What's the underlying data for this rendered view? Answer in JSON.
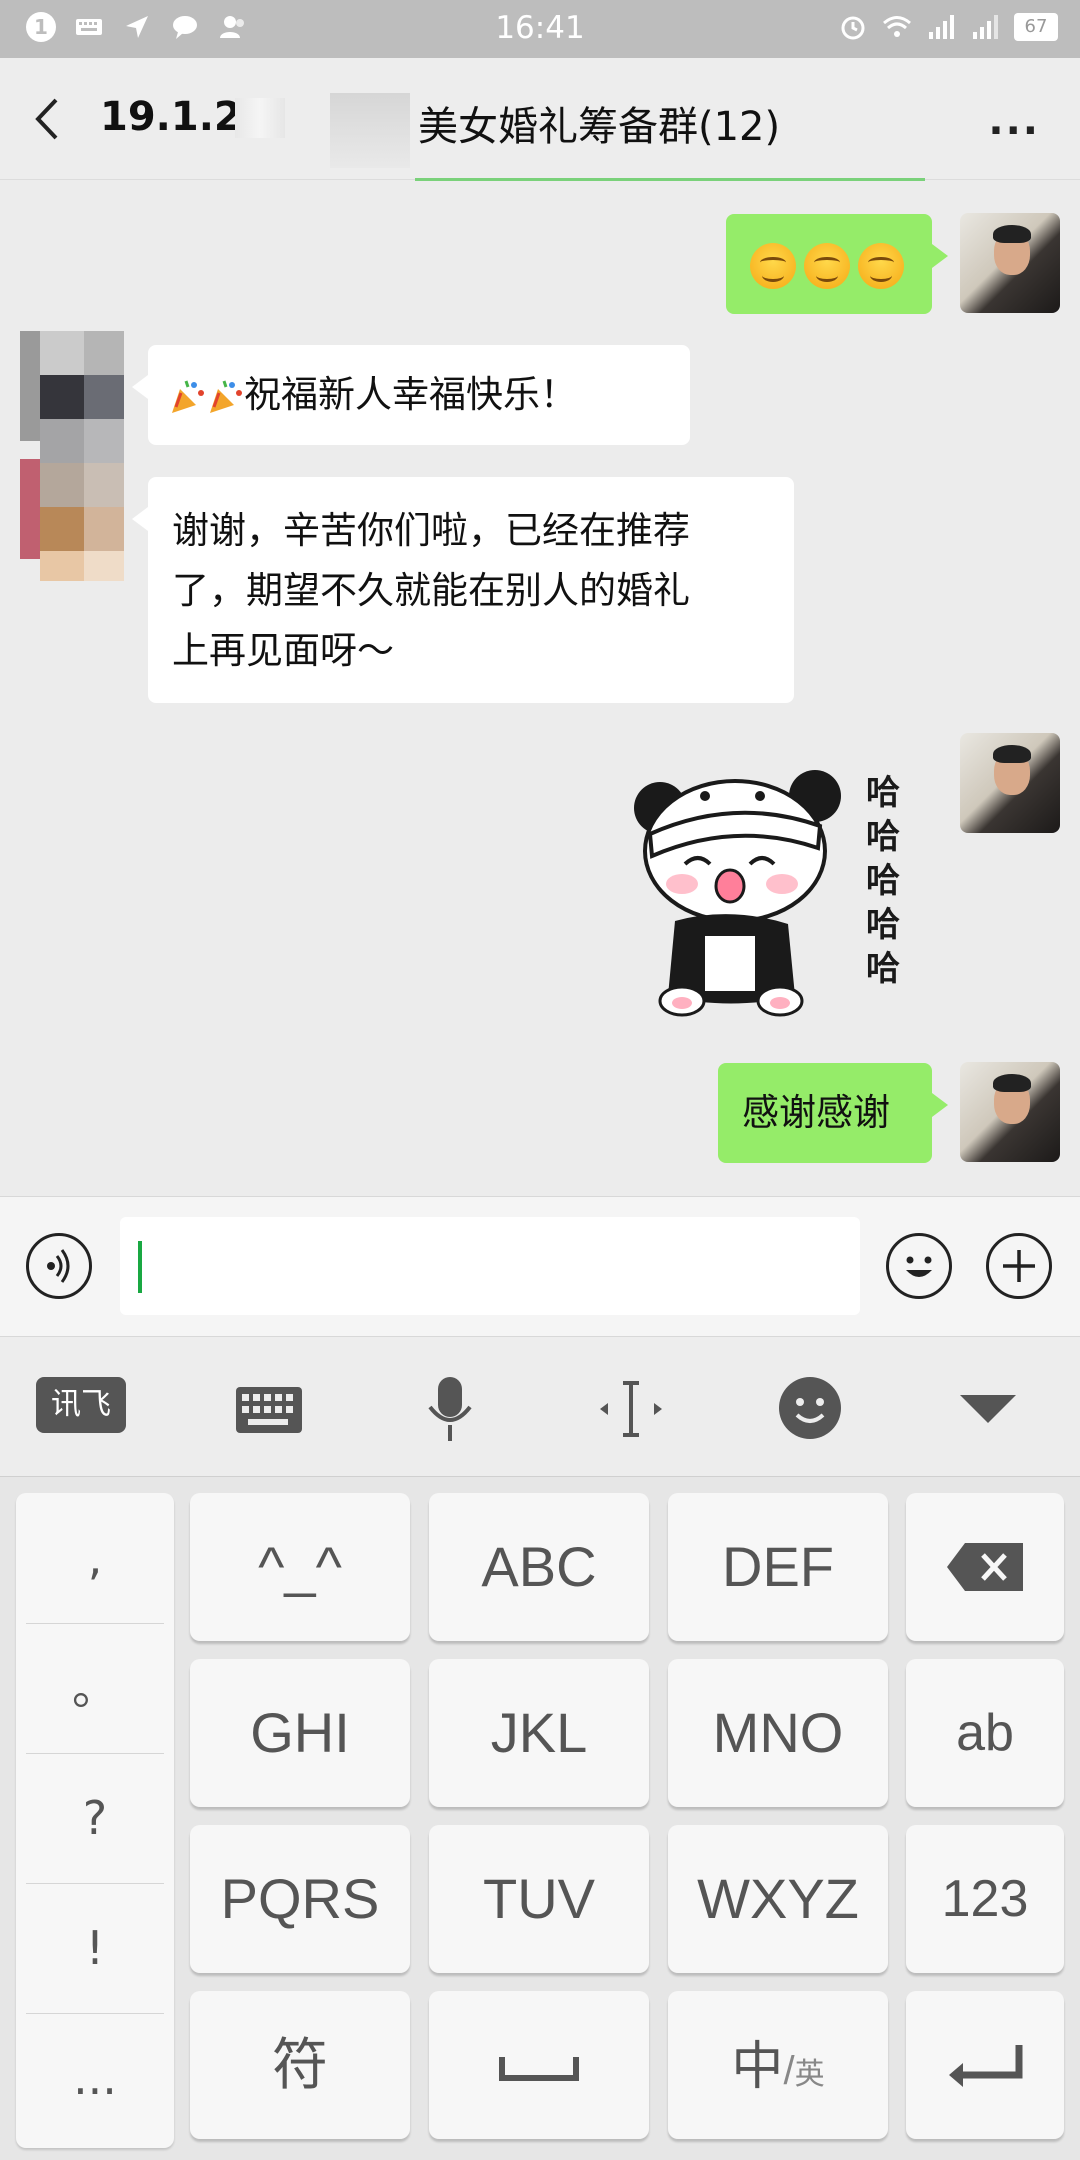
{
  "status_bar": {
    "notification_count": "1",
    "time": "16:41",
    "battery": "67"
  },
  "header": {
    "date_text": "19.1.21",
    "title": "美女婚礼筹备群(12)",
    "more": "···"
  },
  "messages": {
    "m1_emoji": "😊😊😊",
    "m2_text": "祝福新人幸福快乐！",
    "m3_text_line1": "谢谢，辛苦你们啦，已经在推荐",
    "m3_text_line2": "了，期望不久就能在别人的婚礼",
    "m3_text_line3": "上再见面呀～",
    "m4_sticker_text": [
      "哈",
      "哈",
      "哈",
      "哈",
      "哈"
    ],
    "m5_text": "感谢感谢"
  },
  "input": {
    "value": ""
  },
  "keyboard": {
    "toolbar": {
      "brand": "讯飞"
    },
    "punct": [
      ",",
      "。",
      "?",
      "!",
      "..."
    ],
    "rows": [
      [
        "^_^",
        "ABC",
        "DEF"
      ],
      [
        "GHI",
        "JKL",
        "MNO",
        "ab"
      ],
      [
        "PQRS",
        "TUV",
        "WXYZ",
        "123"
      ],
      [
        "符",
        "",
        "中/英"
      ]
    ],
    "lang_main": "中",
    "lang_sub": "英"
  },
  "colors": {
    "my_bubble": "#95ec69",
    "other_bubble": "#ffffff",
    "status_bar": "#bdbdbd",
    "accent_green": "#19a842"
  }
}
